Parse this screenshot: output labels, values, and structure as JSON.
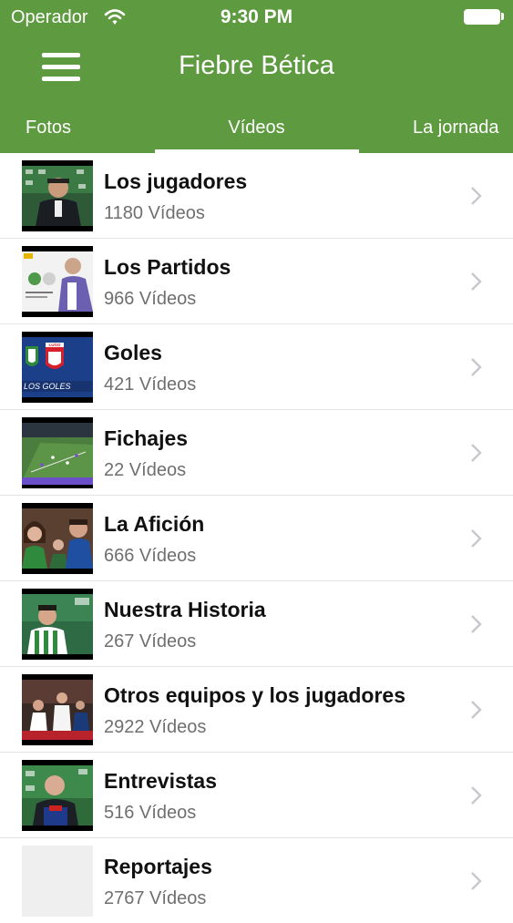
{
  "status_bar": {
    "carrier": "Operador",
    "time": "9:30 PM"
  },
  "header": {
    "title": "Fiebre Bética"
  },
  "tabs": [
    {
      "label": "Fotos"
    },
    {
      "label": "Vídeos",
      "selected": true
    },
    {
      "label": "La jornada"
    }
  ],
  "colors": {
    "brand_green": "#5e9a3f",
    "divider": "#e3e3e3",
    "chevron": "#c7c7cc"
  },
  "categories": [
    {
      "name": "Los jugadores",
      "count": "1180 Vídeos",
      "thumb_icon": "press-conference-thumbnail"
    },
    {
      "name": "Los Partidos",
      "count": "966 Vídeos",
      "thumb_icon": "match-poster-thumbnail"
    },
    {
      "name": "Goles",
      "count": "421 Vídeos",
      "thumb_icon": "goals-crest-thumbnail",
      "thumb_text": "LOS GOLES",
      "thumb_badge": "LUGO"
    },
    {
      "name": "Fichajes",
      "count": "22 Vídeos",
      "thumb_icon": "football-pitch-thumbnail"
    },
    {
      "name": "La Afición",
      "count": "666 Vídeos",
      "thumb_icon": "fans-thumbnail"
    },
    {
      "name": "Nuestra Historia",
      "count": "267 Vídeos",
      "thumb_icon": "player-jersey-thumbnail"
    },
    {
      "name": "Otros equipos y los jugadores",
      "count": "2922 Vídeos",
      "thumb_icon": "match-action-thumbnail"
    },
    {
      "name": "Entrevistas",
      "count": "516 Vídeos",
      "thumb_icon": "interview-thumbnail"
    },
    {
      "name": "Reportajes",
      "count": "2767 Vídeos",
      "thumb_icon": "blank-thumbnail"
    }
  ]
}
